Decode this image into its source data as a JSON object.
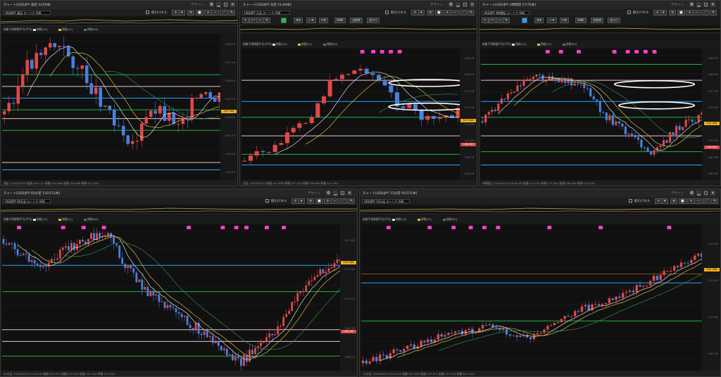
{
  "colors": {
    "bull": "#e04848",
    "bear": "#4a7fe0",
    "blue_line": "#27a0ff",
    "green_line": "#22b04a",
    "pink_line": "#f0c0cc",
    "ma_white": "#dddddd",
    "ma_yellow": "#d4c040",
    "ma_green": "#2e8b57",
    "price_tag": "#f0b020",
    "marker": "#ff3cc8",
    "ellipse": "#ffffff"
  },
  "legend": {
    "heading": "抽象平滑移動平均(平均)",
    "ma1": "移動[10]",
    "ma2": "移動[21]",
    "ma3": "移動[60]"
  },
  "common": {
    "design_label": "デザイン",
    "trade_panel_label": "取引パネル",
    "button_sym": "ANKI",
    "button_delete_all": "全削除",
    "button_reset": "全ロウ"
  },
  "windows": {
    "weekly": {
      "title": "チャート[USD/JPY 週足 4(/56本)",
      "symbol": "USD/JPY 週足 ローソク ASK",
      "status": "週足: 2025/07/20  始値:145.115  高値:144.996  安値:145.065  終値:147.344",
      "price_tag": "147.344",
      "axis_labels": [
        "146.000",
        "145.750",
        "145.500",
        "145.250",
        "145.000",
        "144.750",
        "144.500",
        "144.250"
      ]
    },
    "daily": {
      "title": "チャート[USD/JPY 日足 21/44本]",
      "symbol": "USD/JPY 日足 ローソク ASK",
      "status": "日足: 2025/07/23  始値:147.626  高値:147.410  安値:146.960  終値:147.344",
      "price_tag": "147.344",
      "red_tag": "146.500",
      "axis_labels": [
        "148.250",
        "148.000",
        "147.750",
        "147.500",
        "147.250",
        "147.000",
        "146.750",
        "146.500"
      ]
    },
    "h4": {
      "title": "チャート[USD/JPY 4時間足 57/76本]",
      "symbol": "USD/JPY 4時間足 ローソク ASK",
      "status": "4時間足: 2025/07/23 06:00:00  始値:147.020  高値:147.450  安値:146.906  終値:147.344",
      "price_tag": "147.344",
      "red_tag": "146.500",
      "axis_labels": [
        "148.250",
        "148.000",
        "147.750",
        "147.500",
        "147.250",
        "147.000",
        "146.750",
        "146.500"
      ]
    },
    "m60": {
      "title": "チャート[USD/JPY 60分足 116/151本]",
      "symbol": "USD/JPY 60分足 ローソク ASK",
      "status": "60分足: 2025/07/23 10:00:00  始値:147.224  高値:147.410  安値:147.104  終値:147.344",
      "price_tag": "147.344",
      "red_tag": "146.500",
      "axis_labels": [
        "147.500",
        "147.250",
        "147.000",
        "146.750",
        "146.500"
      ]
    },
    "m15": {
      "title": "チャート[USD/JPY 15分足 95/151本]",
      "symbol": "USD/JPY 15分足 ローソク ASK",
      "status": "15分足: 2025/07/23 10:30:00  始値:147.256  高値:147.411  安値:147.202  終値:147.344",
      "price_tag": "147.344",
      "axis_labels": [
        "147.500",
        "147.250",
        "147.000",
        "146.750"
      ]
    }
  }
}
